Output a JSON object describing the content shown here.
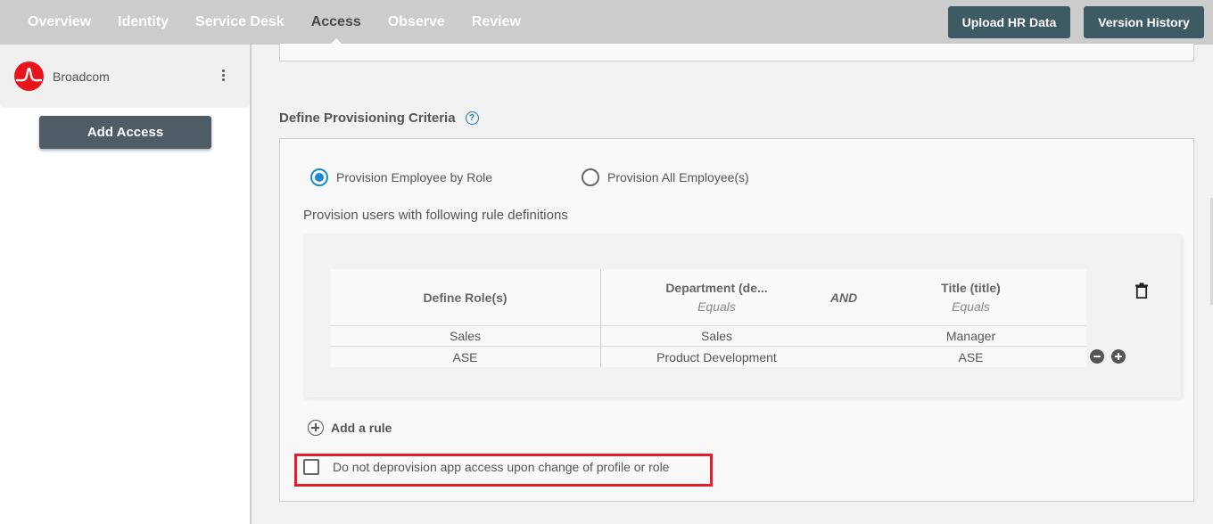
{
  "nav": {
    "tabs": [
      {
        "label": "Overview",
        "active": false
      },
      {
        "label": "Identity",
        "active": false
      },
      {
        "label": "Service Desk",
        "active": false
      },
      {
        "label": "Access",
        "active": true
      },
      {
        "label": "Observe",
        "active": false
      },
      {
        "label": "Review",
        "active": false
      }
    ],
    "upload_label": "Upload HR Data",
    "version_label": "Version History"
  },
  "sidebar": {
    "org_name": "Broadcom",
    "org_icon": "broadcom-logo",
    "menu_icon": "kebab-menu-icon",
    "add_access_label": "Add Access"
  },
  "criteria": {
    "title": "Define Provisioning Criteria",
    "help_icon": "help-circle-icon",
    "radio_by_role": "Provision Employee by Role",
    "radio_all": "Provision All Employee(s)",
    "selected": "by_role",
    "rule_description": "Provision users with following rule definitions",
    "table": {
      "col_role": "Define Role(s)",
      "col_dept": "Department (de...",
      "col_dept_op": "Equals",
      "joiner": "AND",
      "col_title": "Title (title)",
      "col_title_op": "Equals",
      "rows": [
        {
          "role": "Sales",
          "department": "Sales",
          "title": "Manager"
        },
        {
          "role": "ASE",
          "department": "Product Development",
          "title": "ASE"
        }
      ]
    },
    "add_rule_label": "Add a rule",
    "deprovision_label": "Do not deprovision app access upon change of profile or role",
    "deprovision_checked": false,
    "highlight_color": "#e31e2b",
    "accent_color": "#1a8ad1"
  }
}
